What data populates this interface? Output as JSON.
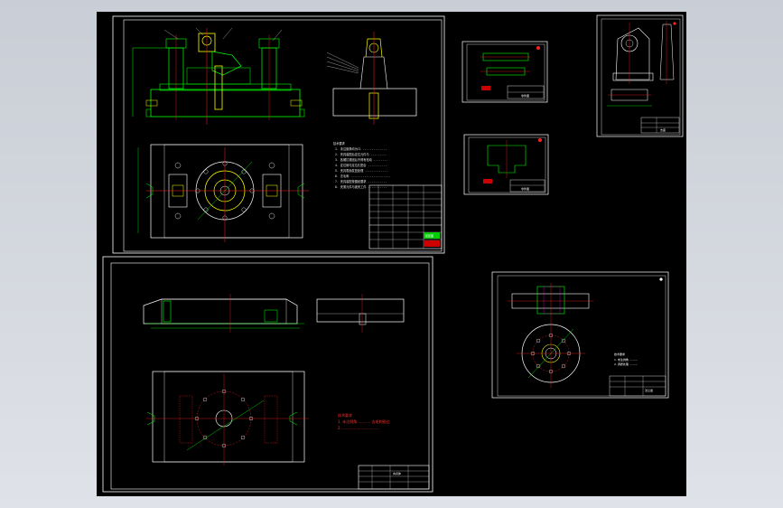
{
  "colors": {
    "background": "#000000",
    "frame": "#ffffff",
    "part": "#00ff00",
    "center_line": "#ff2020",
    "dimension": "#00ffff",
    "highlight": "#ffff00",
    "accent": "#ff00ff"
  },
  "sheets": {
    "assembly": {
      "notes_title": "技术要求",
      "notes": [
        "1. 未注倒角均为C1 ..............",
        "2. 夹具装配后定位元件与 .........",
        "3. 各螺钉紧固后不得有松动 ........",
        "4. 定位销与定位孔配合 ...........",
        "5. 夹具表面发蓝处理 .............",
        "6. 去毛刺 .......................",
        "7. 夹具装配按图纸要求 ...........",
        "8. 夹紧元件与被夹工件 ..........."
      ],
      "title_block_label": "装配图"
    },
    "base_plate": {
      "red_notes": [
        "技术要求",
        "1. 未注倒角 ........... 去毛刺锐边",
        "2. ................................"
      ],
      "title_block_label": "夹具体"
    },
    "small_part_1": {
      "title_block_label": "零件图"
    },
    "small_part_2": {
      "title_block_label": "零件图"
    },
    "support": {
      "title_block_label": "支座"
    },
    "flange": {
      "notes_title": "技术要求",
      "notes": [
        "1. 未注倒角 ..........",
        "2. 调质处理 .........."
      ],
      "title_block_label": "法兰盘"
    }
  }
}
